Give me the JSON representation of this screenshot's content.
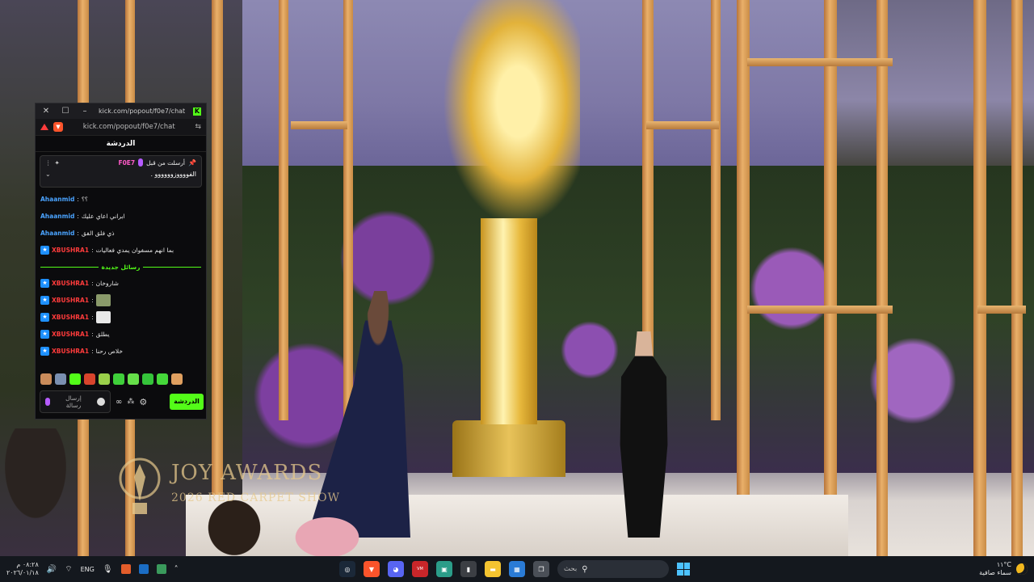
{
  "video": {
    "watermark_title": "JOY AWARDS",
    "watermark_subtitle": "2026 RED CARPET SHOW"
  },
  "chat_window": {
    "title": "kick.com/popout/f0e7/chat...",
    "url": "kick.com/popout/f0e7/chat",
    "header": "الدردشة",
    "pinned": {
      "label": "أرسلت من قبل",
      "user": "F0E7",
      "message": "الفووووزوووووو ."
    },
    "messages_before": [
      {
        "user": "Ahaanmid",
        "text": "؟؟",
        "color": "blue",
        "badge": false
      },
      {
        "user": "Ahaanmid",
        "text": "ابراني اعاي عليك",
        "color": "blue",
        "badge": false
      },
      {
        "user": "Ahaanmid",
        "text": "ذي فلق الفق",
        "color": "blue",
        "badge": false
      },
      {
        "user": "XBUSHRA1",
        "text": "بما انهم مسفوان يمدي فعاليات",
        "color": "red",
        "badge": true
      }
    ],
    "new_messages_label": "رسائل جديدة",
    "messages_after": [
      {
        "user": "XBUSHRA1",
        "text": "شاروخان",
        "color": "red",
        "badge": true,
        "thumb": ""
      },
      {
        "user": "XBUSHRA1",
        "text": "",
        "color": "red",
        "badge": true,
        "thumb": "image-1"
      },
      {
        "user": "XBUSHRA1",
        "text": "",
        "color": "red",
        "badge": true,
        "thumb": "image-2"
      },
      {
        "user": "XBUSHRA1",
        "text": "يطلق",
        "color": "red",
        "badge": true,
        "thumb": ""
      },
      {
        "user": "XBUSHRA1",
        "text": "خلاص رحنا",
        "color": "red",
        "badge": true,
        "thumb": ""
      }
    ],
    "input_placeholder": "إرسال رسالة",
    "send_label": "الدردشة",
    "accent": "#53fc18"
  },
  "taskbar": {
    "time": "٠٨:٢٨ م",
    "date": "٢٠٢٦/٠١/١٨",
    "language": "ENG",
    "search_placeholder": "بحث",
    "weather_temp": "١١°C",
    "weather_desc": "سماء صافية"
  }
}
